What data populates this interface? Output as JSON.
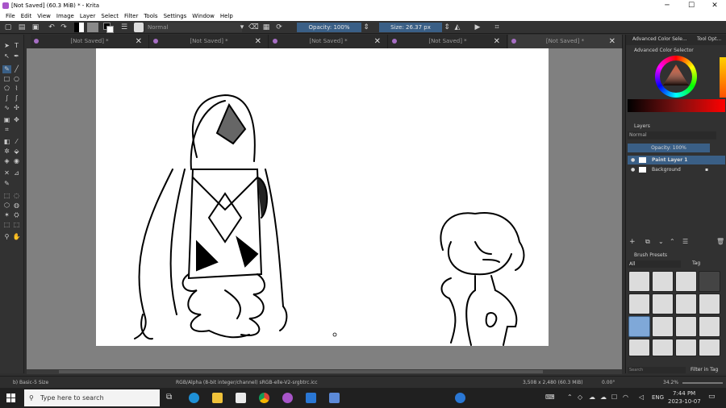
{
  "window": {
    "title": "[Not Saved]  (60.3 MiB)  * - Krita",
    "min": "─",
    "max": "☐",
    "close": "✕"
  },
  "menu": [
    "File",
    "Edit",
    "View",
    "Image",
    "Layer",
    "Select",
    "Filter",
    "Tools",
    "Settings",
    "Window",
    "Help"
  ],
  "toolbar": {
    "blend_mode": "Normal",
    "opacity": "Opacity: 100%",
    "size": "Size: 26.37 px"
  },
  "tabs": [
    {
      "label": "[Not Saved] *"
    },
    {
      "label": "[Not Saved] *"
    },
    {
      "label": "[Not Saved] *"
    },
    {
      "label": "[Not Saved] *"
    },
    {
      "label": "[Not Saved] *"
    }
  ],
  "dock": {
    "top_tabs": [
      "Advanced Color Sele...",
      "Tool Opt..."
    ],
    "color_selector_title": "Advanced Color Selector",
    "layers_title": "Layers",
    "layers_blend": "Normal",
    "layers_opacity": "Opacity:  100%",
    "layers": [
      {
        "name": "Paint Layer 1",
        "active": true
      },
      {
        "name": "Background",
        "active": false
      }
    ],
    "brush_title": "Brush Presets",
    "brush_filter": "All",
    "brush_tag": "Tag",
    "search_placeholder": "Search",
    "filter_in_tag": "Filter in Tag"
  },
  "status": {
    "brush": "b) Basic-5 Size",
    "color_info": "RGB/Alpha (8-bit integer/channel)  sRGB-elle-V2-srgbtrc.icc",
    "dimensions": "3,508 x 2,480 (60.3 MiB)",
    "rotation": "0.00°",
    "zoom": "34.2%"
  },
  "taskbar": {
    "search": "Type here to search",
    "lang": "ENG",
    "time": "7:44 PM",
    "date": "2023-10-07"
  },
  "colors": {
    "accent": "#3a5f86",
    "canvas_bg": "#808080",
    "paint": "#ffffff"
  }
}
